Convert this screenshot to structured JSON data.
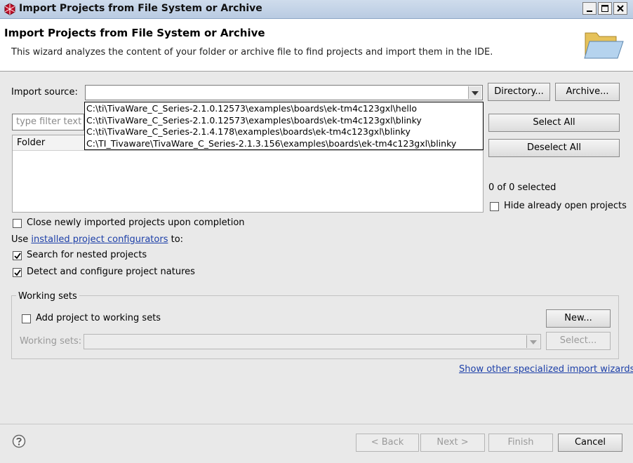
{
  "window": {
    "title": "Import Projects from File System or Archive"
  },
  "header": {
    "title": "Import Projects from File System or Archive",
    "description": "This wizard analyzes the content of your folder or archive file to find projects and import them in the IDE."
  },
  "import_source": {
    "label": "Import source:",
    "value": "",
    "directory_label": "Directory...",
    "archive_label": "Archive...",
    "dropdown_options": [
      "C:\\ti\\TivaWare_C_Series-2.1.0.12573\\examples\\boards\\ek-tm4c123gxl\\hello",
      "C:\\ti\\TivaWare_C_Series-2.1.0.12573\\examples\\boards\\ek-tm4c123gxl\\blinky",
      "C:\\ti\\TivaWare_C_Series-2.1.4.178\\examples\\boards\\ek-tm4c123gxl\\blinky",
      "C:\\TI_Tivaware\\TivaWare_C_Series-2.1.3.156\\examples\\boards\\ek-tm4c123gxl\\blinky"
    ]
  },
  "filter": {
    "placeholder": "type filter text"
  },
  "table": {
    "folder_header": "Folder"
  },
  "side": {
    "select_all": "Select All",
    "deselect_all": "Deselect All",
    "selected_count": "0 of 0 selected",
    "hide_open_label": "Hide already open projects"
  },
  "options": {
    "close_newly_label": "Close newly imported projects upon completion",
    "use_prefix": "Use ",
    "configurators_link": "installed project configurators",
    "use_suffix": " to:",
    "search_nested_label": "Search for nested projects",
    "detect_natures_label": "Detect and configure project natures"
  },
  "working_sets": {
    "group_label": "Working sets",
    "add_label": "Add project to working sets",
    "new_label": "New...",
    "sets_label": "Working sets:",
    "select_label": "Select..."
  },
  "links": {
    "other_wizards": "Show other specialized import wizards"
  },
  "footer": {
    "back": "< Back",
    "next": "Next >",
    "finish": "Finish",
    "cancel": "Cancel"
  },
  "colors": {
    "link": "#1c3fa8",
    "titlebar": "#cfdcec",
    "eclipse_icon": "#c0102a"
  }
}
